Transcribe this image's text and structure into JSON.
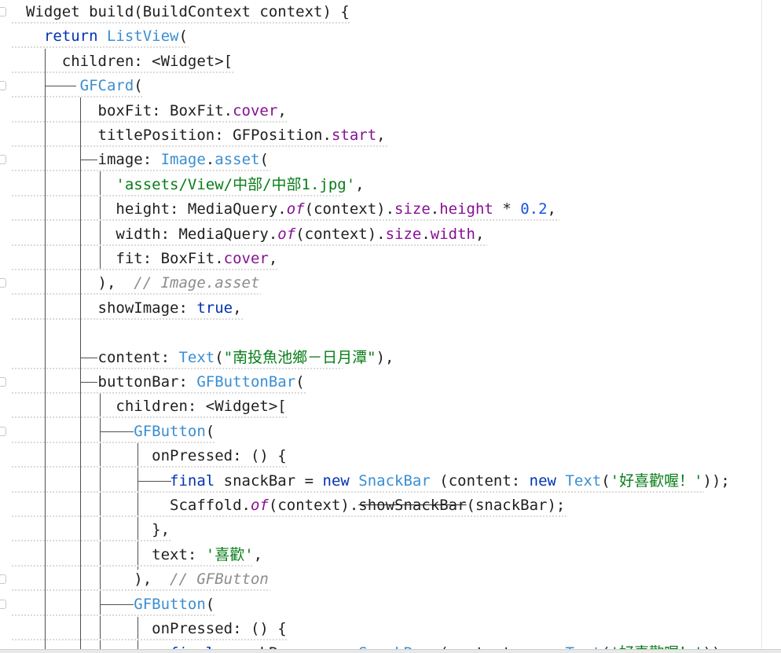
{
  "editor": {
    "lines": [
      [
        {
          "t": "Widget build(BuildContext context) {",
          "c": "plain"
        }
      ],
      [
        {
          "t": "  ",
          "c": "plain"
        },
        {
          "t": "return",
          "c": "kw"
        },
        {
          "t": " ",
          "c": "plain"
        },
        {
          "t": "ListView",
          "c": "class"
        },
        {
          "t": "(",
          "c": "plain"
        }
      ],
      [
        {
          "t": "    children: <Widget>[",
          "c": "plain"
        }
      ],
      [
        {
          "t": "      ",
          "c": "plain"
        },
        {
          "t": "GFCard",
          "c": "class"
        },
        {
          "t": "(",
          "c": "plain"
        }
      ],
      [
        {
          "t": "        boxFit: BoxFit.",
          "c": "plain"
        },
        {
          "t": "cover",
          "c": "prop"
        },
        {
          "t": ",",
          "c": "plain"
        }
      ],
      [
        {
          "t": "        titlePosition: GFPosition.",
          "c": "plain"
        },
        {
          "t": "start",
          "c": "prop"
        },
        {
          "t": ",",
          "c": "plain"
        }
      ],
      [
        {
          "t": "        image: ",
          "c": "plain"
        },
        {
          "t": "Image",
          "c": "class"
        },
        {
          "t": ".",
          "c": "plain"
        },
        {
          "t": "asset",
          "c": "class"
        },
        {
          "t": "(",
          "c": "plain"
        }
      ],
      [
        {
          "t": "          ",
          "c": "plain"
        },
        {
          "t": "'assets/View/中部/中部1.jpg'",
          "c": "str"
        },
        {
          "t": ",",
          "c": "plain"
        }
      ],
      [
        {
          "t": "          height: MediaQuery.",
          "c": "plain"
        },
        {
          "t": "of",
          "c": "ital-prop"
        },
        {
          "t": "(context).",
          "c": "plain"
        },
        {
          "t": "size",
          "c": "prop"
        },
        {
          "t": ".",
          "c": "plain"
        },
        {
          "t": "height",
          "c": "prop"
        },
        {
          "t": " * ",
          "c": "plain"
        },
        {
          "t": "0.2",
          "c": "num"
        },
        {
          "t": ",",
          "c": "plain"
        }
      ],
      [
        {
          "t": "          width: MediaQuery.",
          "c": "plain"
        },
        {
          "t": "of",
          "c": "ital-prop"
        },
        {
          "t": "(context).",
          "c": "plain"
        },
        {
          "t": "size",
          "c": "prop"
        },
        {
          "t": ".",
          "c": "plain"
        },
        {
          "t": "width",
          "c": "prop"
        },
        {
          "t": ",",
          "c": "plain"
        }
      ],
      [
        {
          "t": "          fit: BoxFit.",
          "c": "plain"
        },
        {
          "t": "cover",
          "c": "prop"
        },
        {
          "t": ",",
          "c": "plain"
        }
      ],
      [
        {
          "t": "        ),  ",
          "c": "plain"
        },
        {
          "t": "// Image.asset",
          "c": "comment"
        }
      ],
      [
        {
          "t": "        showImage: ",
          "c": "plain"
        },
        {
          "t": "true",
          "c": "kw"
        },
        {
          "t": ",",
          "c": "plain"
        }
      ],
      [
        {
          "t": "",
          "c": "plain"
        }
      ],
      [
        {
          "t": "        content: ",
          "c": "plain"
        },
        {
          "t": "Text",
          "c": "class"
        },
        {
          "t": "(",
          "c": "plain"
        },
        {
          "t": "\"南投魚池鄉－日月潭\"",
          "c": "str"
        },
        {
          "t": "),",
          "c": "plain"
        }
      ],
      [
        {
          "t": "        buttonBar: ",
          "c": "plain"
        },
        {
          "t": "GFButtonBar",
          "c": "class"
        },
        {
          "t": "(",
          "c": "plain"
        }
      ],
      [
        {
          "t": "          children: <Widget>[",
          "c": "plain"
        }
      ],
      [
        {
          "t": "            ",
          "c": "plain"
        },
        {
          "t": "GFButton",
          "c": "class"
        },
        {
          "t": "(",
          "c": "plain"
        }
      ],
      [
        {
          "t": "              onPressed: () {",
          "c": "plain"
        }
      ],
      [
        {
          "t": "                ",
          "c": "plain"
        },
        {
          "t": "final",
          "c": "kw"
        },
        {
          "t": " snackBar = ",
          "c": "plain"
        },
        {
          "t": "new",
          "c": "kw"
        },
        {
          "t": " ",
          "c": "plain"
        },
        {
          "t": "SnackBar",
          "c": "class"
        },
        {
          "t": " (content: ",
          "c": "plain"
        },
        {
          "t": "new",
          "c": "kw"
        },
        {
          "t": " ",
          "c": "plain"
        },
        {
          "t": "Text",
          "c": "class"
        },
        {
          "t": "(",
          "c": "plain"
        },
        {
          "t": "'好喜歡喔！'",
          "c": "str"
        },
        {
          "t": "));",
          "c": "plain"
        }
      ],
      [
        {
          "t": "                Scaffold.",
          "c": "plain"
        },
        {
          "t": "of",
          "c": "ital-prop"
        },
        {
          "t": "(context).",
          "c": "plain"
        },
        {
          "t": "showSnackBar",
          "c": "strike"
        },
        {
          "t": "(snackBar);",
          "c": "plain"
        }
      ],
      [
        {
          "t": "              },",
          "c": "plain"
        }
      ],
      [
        {
          "t": "              text: ",
          "c": "plain"
        },
        {
          "t": "'喜歡'",
          "c": "str"
        },
        {
          "t": ",",
          "c": "plain"
        }
      ],
      [
        {
          "t": "            ),  ",
          "c": "plain"
        },
        {
          "t": "// GFButton",
          "c": "comment"
        }
      ],
      [
        {
          "t": "            ",
          "c": "plain"
        },
        {
          "t": "GFButton",
          "c": "class"
        },
        {
          "t": "(",
          "c": "plain"
        }
      ],
      [
        {
          "t": "              onPressed: () {",
          "c": "plain"
        }
      ],
      [
        {
          "t": "                ",
          "c": "plain"
        },
        {
          "t": "final",
          "c": "kw"
        },
        {
          "t": " snackBar = ",
          "c": "plain"
        },
        {
          "t": "new",
          "c": "kw"
        },
        {
          "t": " ",
          "c": "plain"
        },
        {
          "t": "SnackBar",
          "c": "class"
        },
        {
          "t": " (content: ",
          "c": "plain"
        },
        {
          "t": "new",
          "c": "kw"
        },
        {
          "t": " ",
          "c": "plain"
        },
        {
          "t": "Text",
          "c": "class"
        },
        {
          "t": "(",
          "c": "plain"
        },
        {
          "t": "'好喜歡喔！'",
          "c": "str"
        },
        {
          "t": "));",
          "c": "plain"
        }
      ]
    ],
    "colors": {
      "keyword": "#0033b3",
      "class": "#3b8ed0",
      "property": "#871094",
      "string": "#067d17",
      "number": "#1750eb",
      "comment": "#8c8c8c",
      "text": "#1f1f1f"
    }
  }
}
